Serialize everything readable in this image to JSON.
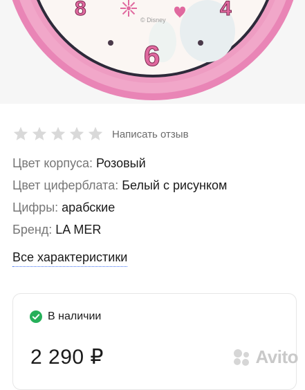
{
  "photo": {
    "alt": "pink wall clock",
    "dial_numbers": [
      "8",
      "6",
      "4"
    ],
    "dial_brand": "Disney"
  },
  "rating": {
    "stars_filled": 0,
    "stars_total": 5,
    "review_link": "Написать отзыв"
  },
  "specs": [
    {
      "key": "Цвет корпуса:",
      "value": "Розовый"
    },
    {
      "key": "Цвет циферблата:",
      "value": "Белый с рисунком"
    },
    {
      "key": "Цифры:",
      "value": "арабские"
    },
    {
      "key": "Бренд:",
      "value": "LA MER"
    }
  ],
  "all_specs_link": "Все характеристики",
  "offer": {
    "availability": "В наличии",
    "price": "2 290 ₽"
  },
  "watermark": "Avito",
  "colors": {
    "star_empty": "#d9d9d9",
    "in_stock": "#26b05a",
    "link_underline": "#3a6df0",
    "clock_pink": "#e985b6"
  }
}
